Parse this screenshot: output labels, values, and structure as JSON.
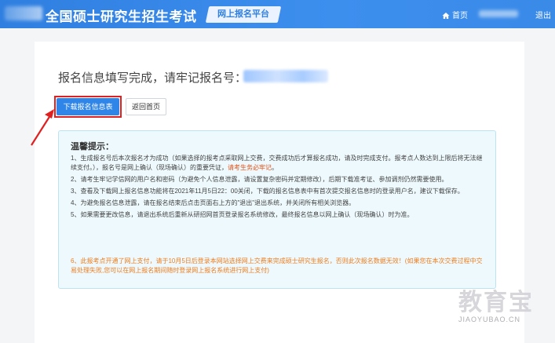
{
  "header": {
    "site_title": "全国硕士研究生招生考试",
    "platform_badge": "网上报名平台",
    "home_label": "首页",
    "logout_label": "退出"
  },
  "main": {
    "heading": "报名信息填写完成，请牢记报名号：",
    "download_button": "下载报名信息表",
    "back_button": "返回首页"
  },
  "tips": {
    "title": "温馨提示：",
    "item1_prefix": "1、生成报名号后本次报名才为成功（如果选择的报考点采取网上交费，交费成功后才算报名成功，请及时完成支付。报考点人数达到上限后将无法继续支付。），报名号是网上确认（现场确认）的重要凭证，",
    "item1_highlight": "请考生务必牢记",
    "item1_suffix": "。",
    "item2": "2、请考生牢记学信网的用户名和密码（为避免个人信息泄露，请设置复杂密码并定期修改），后期下载准考证、参加调剂仍然需要使用。",
    "item3": "3、查看及下载网上报名信息功能将在2021年11月5日22：00关闭，下载的报名信息表中有首次提交报名信息时的登录用户名，建议下载保存。",
    "item4": "4、为避免报名信息泄露，请在报名结束后点击页面右上方的\"退出\"退出系统，并关闭所有相关浏览器。",
    "item5": "5、如果需要更改信息，请退出系统后重新从研招网首页登录报名系统修改，最终报名信息以网上确认（现场确认）时为准。",
    "item6": "6、此报考点开通了网上支付，请于10月5日后登录本网站选择网上交费来完成硕士研究生报名，否则此次报名数据无效！(如果您在本次交费过程中交易处理失败,您可以在网上报名期间随时登录网上报名系统进行网上支付)"
  },
  "watermark": {
    "cn": "教育宝",
    "en": "JIAOYUBAO.CN"
  },
  "colors": {
    "header_blue": "#2f7fe0",
    "button_blue": "#2f86e8",
    "highlight_red": "#e02020",
    "warning_orange": "#ef7d1e"
  }
}
